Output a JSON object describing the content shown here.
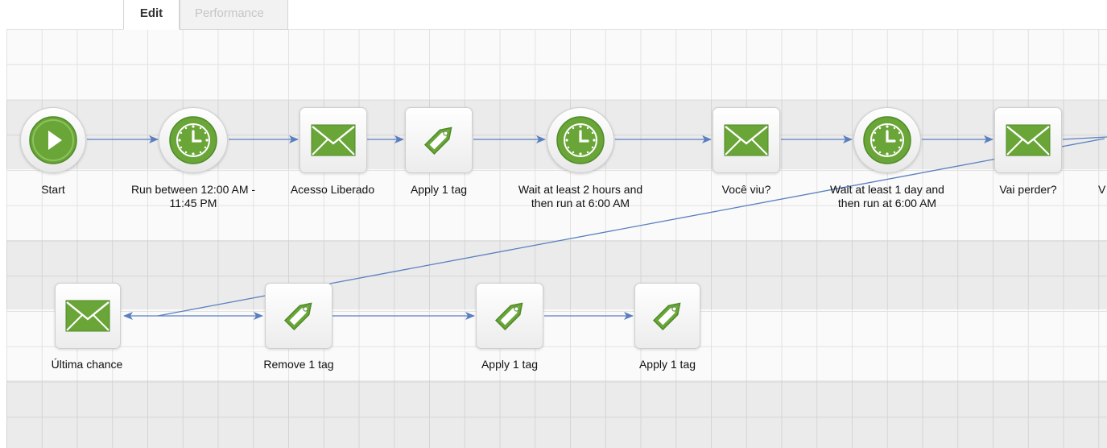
{
  "tabs": {
    "edit": "Edit",
    "performance": "Performance"
  },
  "colors": {
    "accent_green": "#6aa538",
    "link_blue": "#5a7fbf"
  },
  "nodes": [
    {
      "name": "start",
      "label": "Start",
      "icon": "play-icon"
    },
    {
      "name": "run-between",
      "label1": "Run between 12:00 AM -",
      "label2": "11:45 PM",
      "icon": "clock-icon"
    },
    {
      "name": "acesso-liberado",
      "label": "Acesso Liberado",
      "icon": "email-icon"
    },
    {
      "name": "apply-tag-1",
      "label": "Apply 1 tag",
      "icon": "tag-icon"
    },
    {
      "name": "wait-2-hours",
      "label1": "Wait at least 2 hours and",
      "label2": "then run at 6:00 AM",
      "icon": "clock-icon"
    },
    {
      "name": "voce-viu",
      "label": "Você viu?",
      "icon": "email-icon"
    },
    {
      "name": "wait-1-day",
      "label1": "Wait at least 1 day and",
      "label2": "then run at 6:00 AM",
      "icon": "clock-icon"
    },
    {
      "name": "vai-perder",
      "label": "Vai perder?",
      "icon": "email-icon"
    },
    {
      "name": "cut-off",
      "label": "V",
      "icon": ""
    },
    {
      "name": "ultima-chance",
      "label": "Última chance",
      "icon": "email-icon"
    },
    {
      "name": "remove-tag",
      "label": "Remove 1 tag",
      "icon": "tag-icon"
    },
    {
      "name": "apply-tag-2",
      "label": "Apply 1 tag",
      "icon": "tag-icon"
    },
    {
      "name": "apply-tag-3",
      "label": "Apply 1 tag",
      "icon": "tag-icon"
    }
  ]
}
